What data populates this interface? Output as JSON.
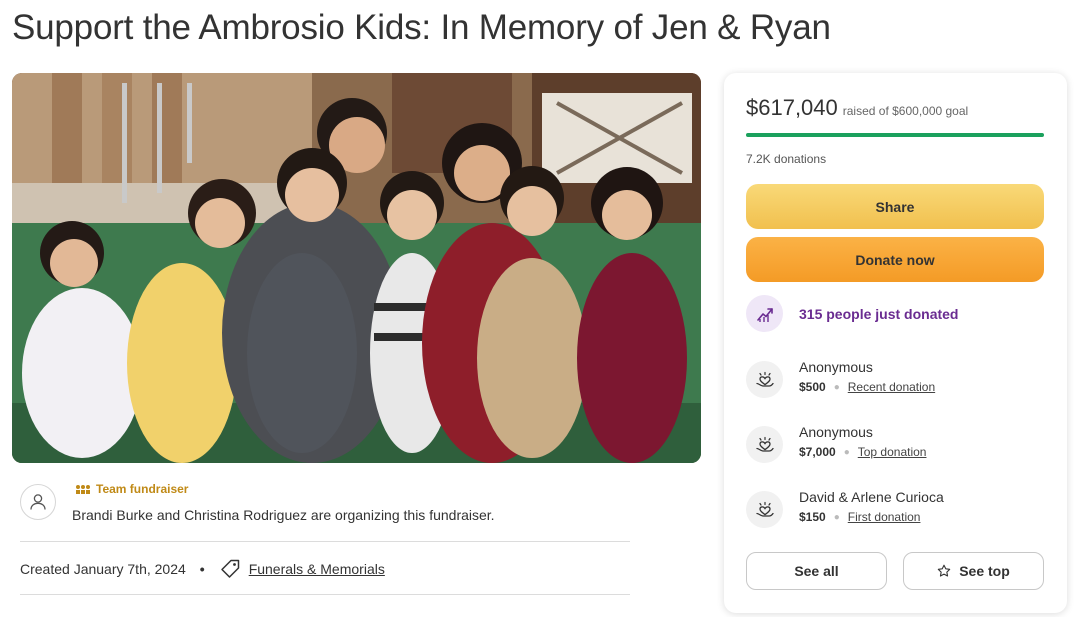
{
  "page": {
    "title": "Support the Ambrosio Kids: In Memory of Jen & Ryan"
  },
  "organizer": {
    "badge": "Team fundraiser",
    "text": "Brandi Burke and Christina Rodriguez are organizing this fundraiser."
  },
  "meta": {
    "created": "Created January 7th, 2024",
    "separator": "•",
    "category": "Funerals & Memorials"
  },
  "donation_card": {
    "amount_raised": "$617,040",
    "goal_text": "raised of $600,000 goal",
    "progress_fraction": 1.0,
    "donations_count": "7.2K donations",
    "share_label": "Share",
    "donate_label": "Donate now",
    "recent_activity": "315 people just donated",
    "donors": [
      {
        "name": "Anonymous",
        "amount": "$500",
        "type": "Recent donation"
      },
      {
        "name": "Anonymous",
        "amount": "$7,000",
        "type": "Top donation"
      },
      {
        "name": "David & Arlene Curioca",
        "amount": "$150",
        "type": "First donation"
      }
    ],
    "see_all_label": "See all",
    "see_top_label": "See top"
  },
  "colors": {
    "progress": "#1ba15d",
    "share_button": "#f4c95a",
    "donate_button": "#f7a436",
    "recent_text": "#6a2c91",
    "team_badge": "#c08a17"
  }
}
